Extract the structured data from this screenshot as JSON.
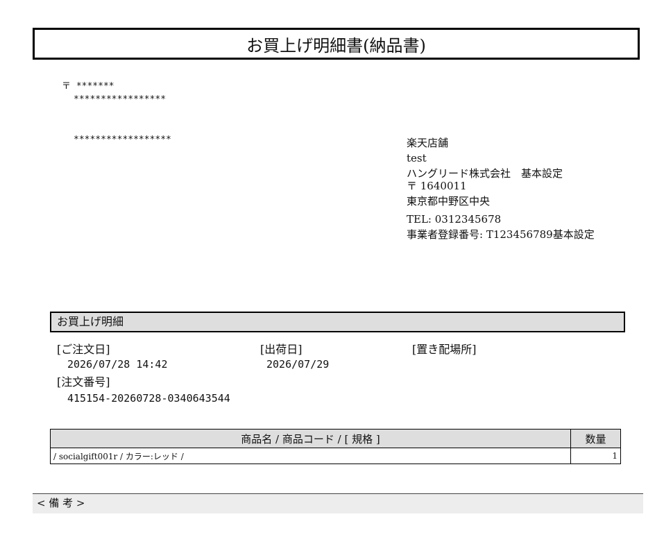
{
  "document": {
    "title": "お買上げ明細書(納品書)"
  },
  "recipient": {
    "postal": "〒 *******",
    "address": "*****************",
    "name": "******************"
  },
  "store": {
    "name": "楽天店舗",
    "sub": "test",
    "company": "ハングリード株式会社　基本設定",
    "postal": "〒 1640011",
    "address": "東京都中野区中央",
    "tel": "TEL: 0312345678",
    "registration": "事業者登録番号: T123456789基本設定"
  },
  "details": {
    "section_title": "お買上げ明細",
    "order_date_label": "[ご注文日]",
    "order_date": "2026/07/28 14:42",
    "ship_date_label": "[出荷日]",
    "ship_date": "2026/07/29",
    "delivery_place_label": "[置き配場所]",
    "order_number_label": "[注文番号]",
    "order_number": "415154-20260728-0340643544"
  },
  "items_table": {
    "headers": [
      "商品名 / 商品コード / [ 規格 ]",
      "数量"
    ],
    "rows": [
      {
        "product": "/ socialgift001r / カラー:レッド /",
        "quantity": "1"
      }
    ]
  },
  "remarks": {
    "label": "< 備 考 >"
  }
}
